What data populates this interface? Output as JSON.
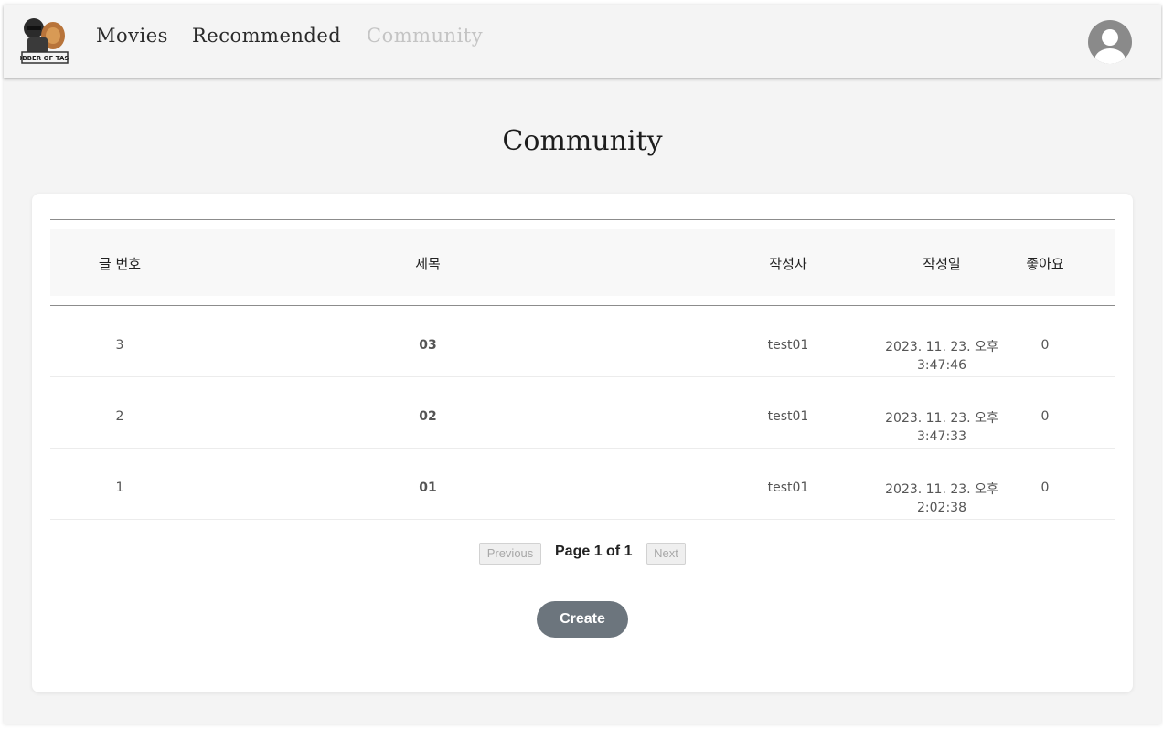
{
  "nav": {
    "links": [
      {
        "label": "Movies"
      },
      {
        "label": "Recommended"
      },
      {
        "label": "Community"
      }
    ],
    "logo_text": "ROBBER OF TASTE",
    "colors": {
      "active_link": "#c4c4c4",
      "link": "#2a2a2a"
    }
  },
  "page": {
    "title": "Community"
  },
  "table": {
    "columns": [
      "글 번호",
      "제목",
      "작성자",
      "작성일",
      "좋아요"
    ],
    "rows": [
      {
        "num": "3",
        "title": "03",
        "author": "test01",
        "date_line1": "2023. 11. 23. 오후",
        "date_line2": "3:47:46",
        "likes": "0"
      },
      {
        "num": "2",
        "title": "02",
        "author": "test01",
        "date_line1": "2023. 11. 23. 오후",
        "date_line2": "3:47:33",
        "likes": "0"
      },
      {
        "num": "1",
        "title": "01",
        "author": "test01",
        "date_line1": "2023. 11. 23. 오후",
        "date_line2": "2:02:38",
        "likes": "0"
      }
    ]
  },
  "pagination": {
    "previous_label": "Previous",
    "page_info": "Page 1 of 1",
    "next_label": "Next"
  },
  "actions": {
    "create_label": "Create",
    "create_color": "#6c757d"
  }
}
